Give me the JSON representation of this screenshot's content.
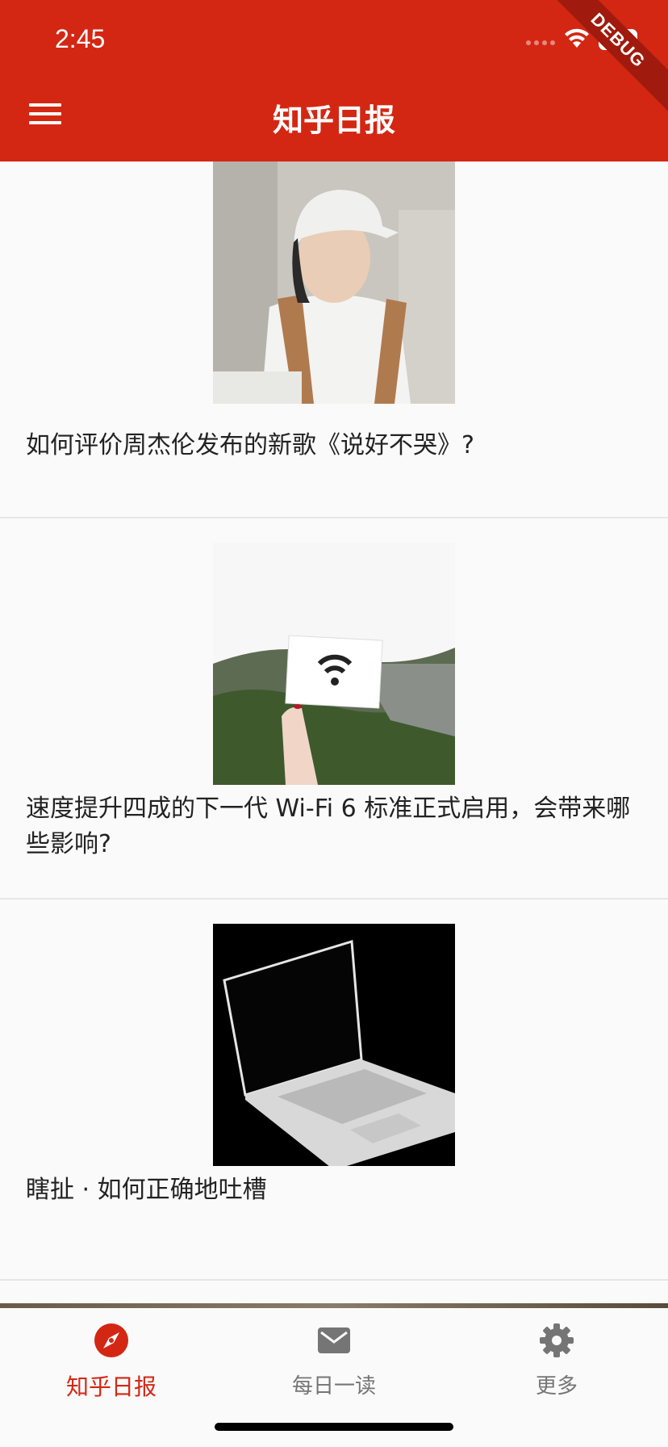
{
  "status": {
    "time": "2:45",
    "debug_label": "DEBUG"
  },
  "appbar": {
    "title": "知乎日报"
  },
  "feed": {
    "items": [
      {
        "title": "如何评价周杰伦发布的新歌《说好不哭》?"
      },
      {
        "title": "速度提升四成的下一代 Wi-Fi 6 标准正式启用，会带来哪些影响?"
      },
      {
        "title": "瞎扯 · 如何正确地吐槽"
      }
    ]
  },
  "tabs": [
    {
      "label": "知乎日报",
      "icon": "compass-icon",
      "active": true
    },
    {
      "label": "每日一读",
      "icon": "mail-icon",
      "active": false
    },
    {
      "label": "更多",
      "icon": "gear-icon",
      "active": false
    }
  ],
  "colors": {
    "primary": "#d32714",
    "active_tab": "#d32714",
    "inactive_tab": "#757575"
  }
}
